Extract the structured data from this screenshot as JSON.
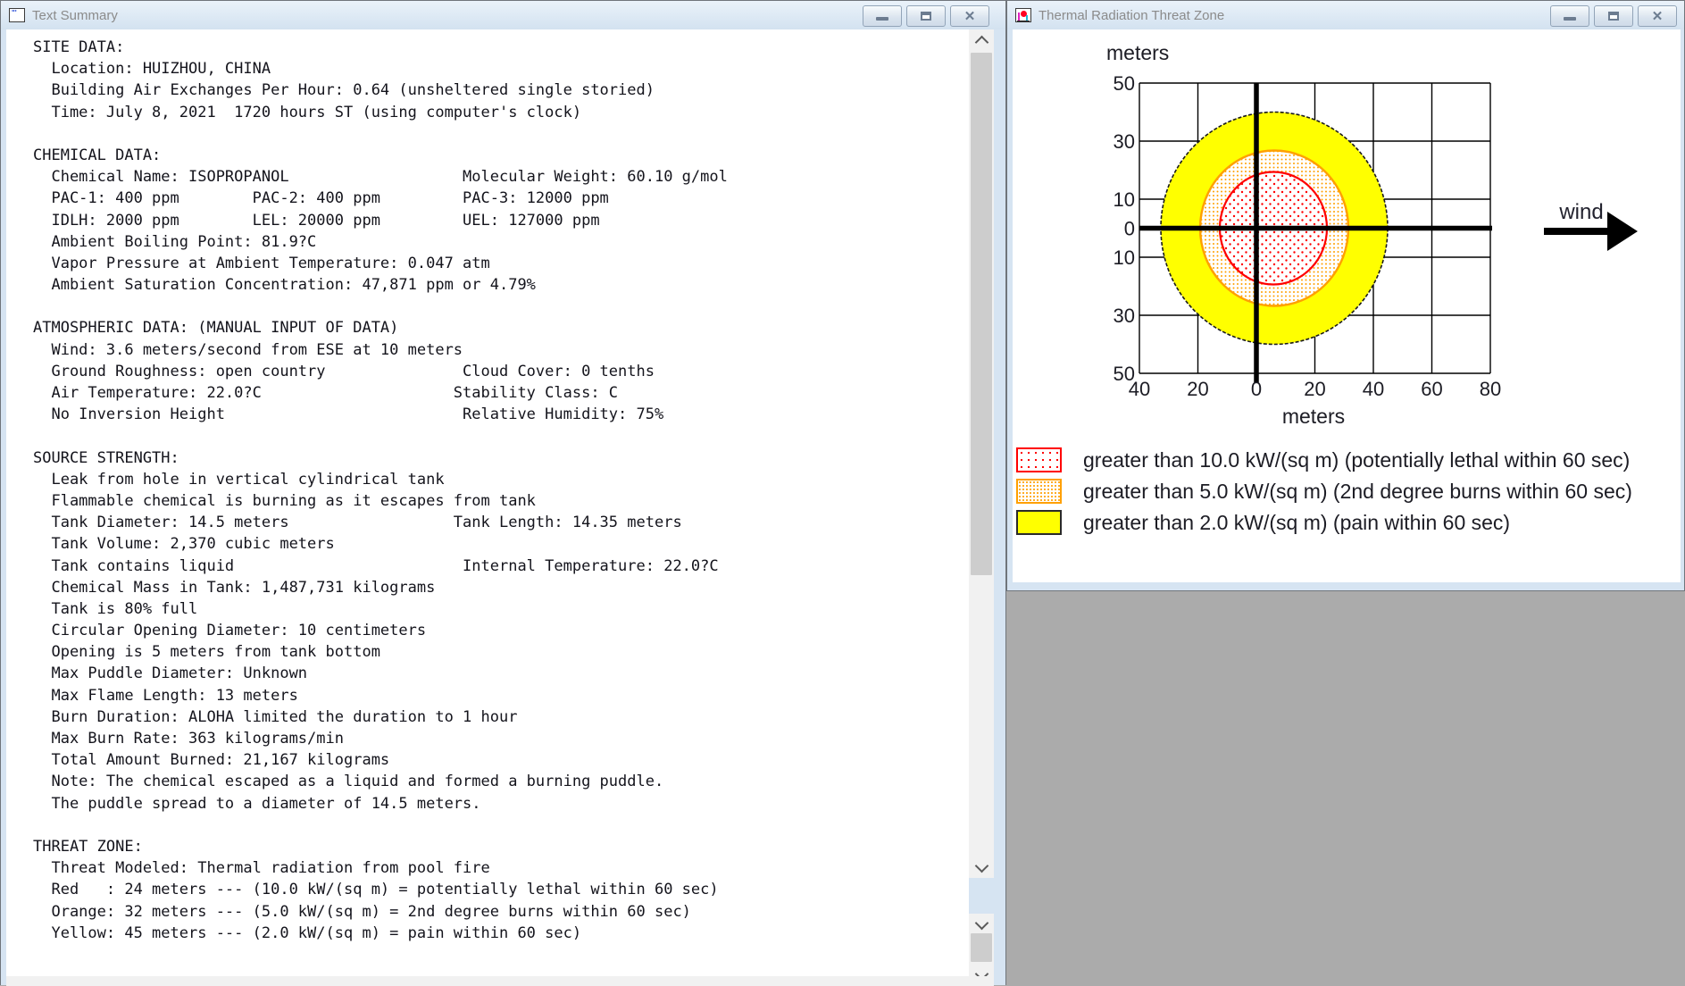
{
  "left_window": {
    "title": "Text Summary",
    "lines": [
      "SITE DATA:",
      "  Location: HUIZHOU, CHINA",
      "  Building Air Exchanges Per Hour: 0.64 (unsheltered single storied)",
      "  Time: July 8, 2021  1720 hours ST (using computer's clock)",
      "",
      "CHEMICAL DATA:",
      "  Chemical Name: ISOPROPANOL                   Molecular Weight: 60.10 g/mol",
      "  PAC-1: 400 ppm        PAC-2: 400 ppm         PAC-3: 12000 ppm",
      "  IDLH: 2000 ppm        LEL: 20000 ppm         UEL: 127000 ppm",
      "  Ambient Boiling Point: 81.9?C",
      "  Vapor Pressure at Ambient Temperature: 0.047 atm",
      "  Ambient Saturation Concentration: 47,871 ppm or 4.79%",
      "",
      "ATMOSPHERIC DATA: (MANUAL INPUT OF DATA)",
      "  Wind: 3.6 meters/second from ESE at 10 meters",
      "  Ground Roughness: open country               Cloud Cover: 0 tenths",
      "  Air Temperature: 22.0?C                     Stability Class: C",
      "  No Inversion Height                          Relative Humidity: 75%",
      "",
      "SOURCE STRENGTH:",
      "  Leak from hole in vertical cylindrical tank",
      "  Flammable chemical is burning as it escapes from tank",
      "  Tank Diameter: 14.5 meters                  Tank Length: 14.35 meters",
      "  Tank Volume: 2,370 cubic meters",
      "  Tank contains liquid                         Internal Temperature: 22.0?C",
      "  Chemical Mass in Tank: 1,487,731 kilograms",
      "  Tank is 80% full",
      "  Circular Opening Diameter: 10 centimeters",
      "  Opening is 5 meters from tank bottom",
      "  Max Puddle Diameter: Unknown",
      "  Max Flame Length: 13 meters",
      "  Burn Duration: ALOHA limited the duration to 1 hour",
      "  Max Burn Rate: 363 kilograms/min",
      "  Total Amount Burned: 21,167 kilograms",
      "  Note: The chemical escaped as a liquid and formed a burning puddle.",
      "  The puddle spread to a diameter of 14.5 meters.",
      "",
      "THREAT ZONE:",
      "  Threat Modeled: Thermal radiation from pool fire",
      "  Red   : 24 meters --- (10.0 kW/(sq m) = potentially lethal within 60 sec)",
      "  Orange: 32 meters --- (5.0 kW/(sq m) = 2nd degree burns within 60 sec)",
      "  Yellow: 45 meters --- (2.0 kW/(sq m) = pain within 60 sec)"
    ],
    "icons": {
      "close_glyph": "✕"
    }
  },
  "right_window": {
    "title": "Thermal Radiation Threat Zone",
    "wind_label": "wind",
    "legend": [
      {
        "swatch": "red-dotted",
        "label": "greater than 10.0 kW/(sq m) (potentially lethal within 60 sec)"
      },
      {
        "swatch": "orange-dotted",
        "label": "greater than 5.0 kW/(sq m) (2nd degree burns within 60 sec)"
      },
      {
        "swatch": "yellow-solid",
        "label": "greater than 2.0 kW/(sq m) (pain within 60 sec)"
      }
    ],
    "chart_data": {
      "type": "area",
      "title": "",
      "xlabel": "meters",
      "ylabel": "meters",
      "xlim": [
        -40,
        80
      ],
      "ylim": [
        -50,
        50
      ],
      "grid": true,
      "x_tick_labels": [
        "40",
        "20",
        "0",
        "20",
        "40",
        "60",
        "80"
      ],
      "y_tick_labels": [
        "50",
        "30",
        "10",
        "0",
        "10",
        "30",
        "50"
      ],
      "zones": [
        {
          "name": "red",
          "threshold": "greater than 10.0 kW/(sq m)",
          "downwind_m": 24,
          "x_extent_m": [
            -12,
            24
          ],
          "y_extent_m": [
            -19.5,
            19.5
          ],
          "color": "#ff0000",
          "fill": "red dots on white"
        },
        {
          "name": "orange",
          "threshold": "greater than 5.0 kW/(sq m)",
          "downwind_m": 32,
          "x_extent_m": [
            -19,
            32
          ],
          "y_extent_m": [
            -27,
            27
          ],
          "color": "#ffa000",
          "fill": "orange dots on white"
        },
        {
          "name": "yellow",
          "threshold": "greater than 2.0 kW/(sq m)",
          "downwind_m": 45,
          "x_extent_m": [
            -32,
            45
          ],
          "y_extent_m": [
            -40,
            40
          ],
          "color": "#ffff00",
          "fill": "solid yellow"
        }
      ],
      "wind_direction": "left-to-right"
    }
  }
}
